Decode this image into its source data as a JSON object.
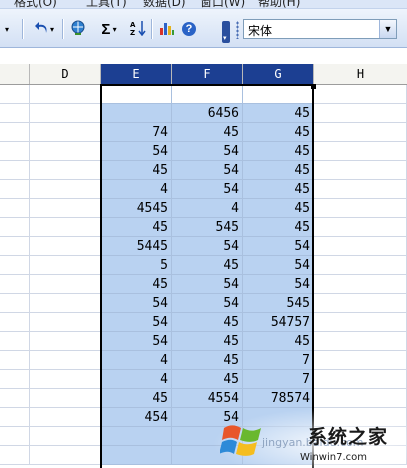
{
  "menu": {
    "items": [
      "格式(O)",
      "工具(T)",
      "数据(D)",
      "窗口(W)",
      "帮助(H)"
    ]
  },
  "toolbar": {
    "buttons": [
      {
        "name": "undo",
        "icon": "undo-icon"
      },
      {
        "name": "hyperlink",
        "icon": "globe-link-icon"
      },
      {
        "name": "autosum",
        "icon": "sigma-icon",
        "label": "Σ"
      },
      {
        "name": "sort-ascending",
        "icon": "sort-az-icon"
      },
      {
        "name": "chart-wizard",
        "icon": "bar-chart-icon"
      },
      {
        "name": "help",
        "icon": "help-icon",
        "label": "?"
      }
    ],
    "font_name": "宋体"
  },
  "sheet": {
    "columns": [
      {
        "label": "D",
        "selected": false
      },
      {
        "label": "E",
        "selected": true
      },
      {
        "label": "F",
        "selected": true
      },
      {
        "label": "G",
        "selected": true
      },
      {
        "label": "H",
        "selected": false
      }
    ],
    "rows": [
      [
        "",
        "",
        "",
        "",
        ""
      ],
      [
        "",
        "",
        "6456",
        "45",
        ""
      ],
      [
        "",
        "74",
        "45",
        "45",
        ""
      ],
      [
        "",
        "54",
        "54",
        "45",
        ""
      ],
      [
        "",
        "45",
        "54",
        "45",
        ""
      ],
      [
        "",
        "4",
        "54",
        "45",
        ""
      ],
      [
        "",
        "4545",
        "4",
        "45",
        ""
      ],
      [
        "",
        "45",
        "545",
        "45",
        ""
      ],
      [
        "",
        "5445",
        "54",
        "54",
        ""
      ],
      [
        "",
        "5",
        "45",
        "54",
        ""
      ],
      [
        "",
        "45",
        "54",
        "54",
        ""
      ],
      [
        "",
        "54",
        "54",
        "545",
        ""
      ],
      [
        "",
        "54",
        "45",
        "54757",
        ""
      ],
      [
        "",
        "54",
        "45",
        "45",
        ""
      ],
      [
        "",
        "4",
        "45",
        "7",
        ""
      ],
      [
        "",
        "4",
        "45",
        "7",
        ""
      ],
      [
        "",
        "45",
        "4554",
        "78574",
        ""
      ],
      [
        "",
        "454",
        "54",
        "",
        ""
      ],
      [
        "",
        "",
        "",
        "",
        ""
      ],
      [
        "",
        "",
        "",
        "",
        ""
      ]
    ],
    "selection_color": "#b9d2f1",
    "header_selected_color": "#1c3f92"
  },
  "watermark": {
    "text": "系统之家",
    "url": "Winwin7.com",
    "faint": "jingyan.baidu.com"
  }
}
